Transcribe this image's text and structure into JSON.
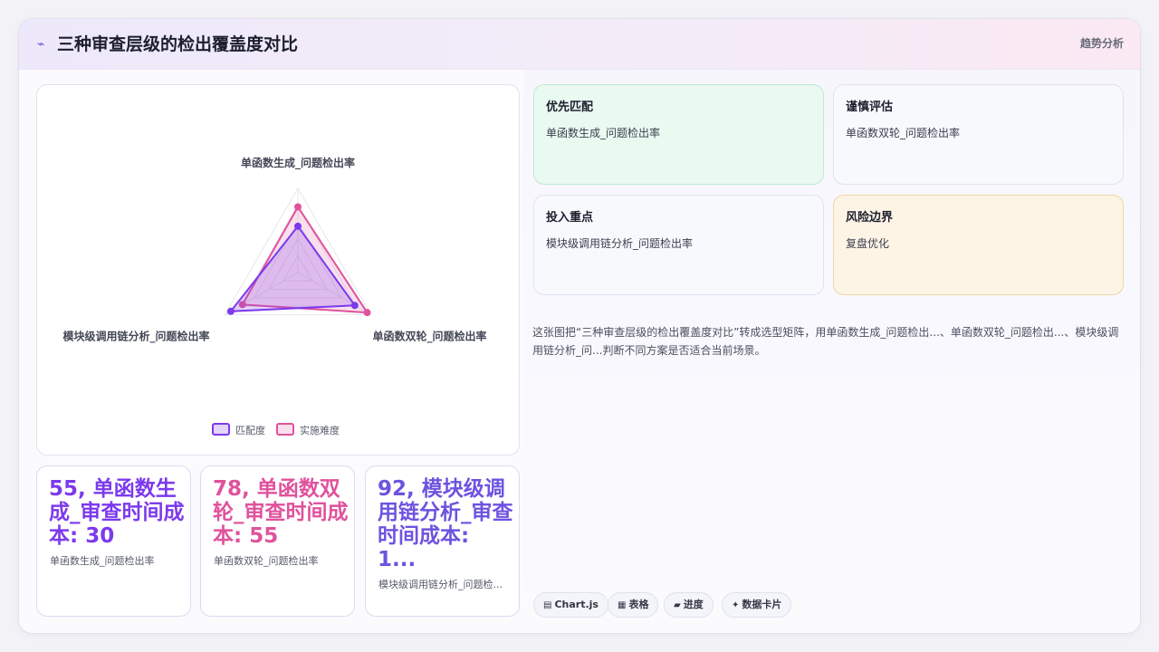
{
  "header": {
    "title": "三种审查层级的检出覆盖度对比",
    "tag": "趋势分析"
  },
  "chart_data": {
    "type": "radar",
    "axes": [
      "单函数生成_问题检出率",
      "单函数双轮_问题检出率",
      "模块级调用链分析_问题检出率"
    ],
    "series": [
      {
        "name": "匹配度",
        "values": [
          55,
          78,
          92
        ],
        "color": "#7c3aed"
      },
      {
        "name": "实施难度",
        "values": [
          78,
          95,
          76
        ],
        "color": "#e0529c"
      }
    ],
    "rmax": 100
  },
  "stats": [
    {
      "value": "55, 单函数生成_审查时间成本: 30",
      "label": "单函数生成_问题检出率",
      "color": "#7c3aed"
    },
    {
      "value": "78, 单函数双轮_审查时间成本: 55",
      "label": "单函数双轮_问题检出率",
      "color": "#e0529c"
    },
    {
      "value": "92, 模块级调用链分析_审查时间成本: 1...",
      "label": "模块级调用链分析_问题检...",
      "color": "#6d53e0"
    }
  ],
  "quadrants": [
    {
      "title": "优先匹配",
      "body": "单函数生成_问题检出率"
    },
    {
      "title": "谨慎评估",
      "body": "单函数双轮_问题检出率"
    },
    {
      "title": "投入重点",
      "body": "模块级调用链分析_问题检出率"
    },
    {
      "title": "风险边界",
      "body": "复盘优化"
    }
  ],
  "description": "这张图把“三种审查层级的检出覆盖度对比”转成选型矩阵，用单函数生成_问题检出...、单函数双轮_问题检出...、模块级调用链分析_问...判断不同方案是否适合当前场景。",
  "chips": [
    {
      "icon": "▤",
      "label": "Chart.js"
    },
    {
      "icon": "▦",
      "label": "表格"
    },
    {
      "icon": "▰",
      "label": "进度"
    },
    {
      "icon": "✦",
      "label": "数据卡片"
    }
  ],
  "colors": {
    "q1": "#e9faf1",
    "q4": "#fdf4e6",
    "accent": "#6a56d9"
  }
}
